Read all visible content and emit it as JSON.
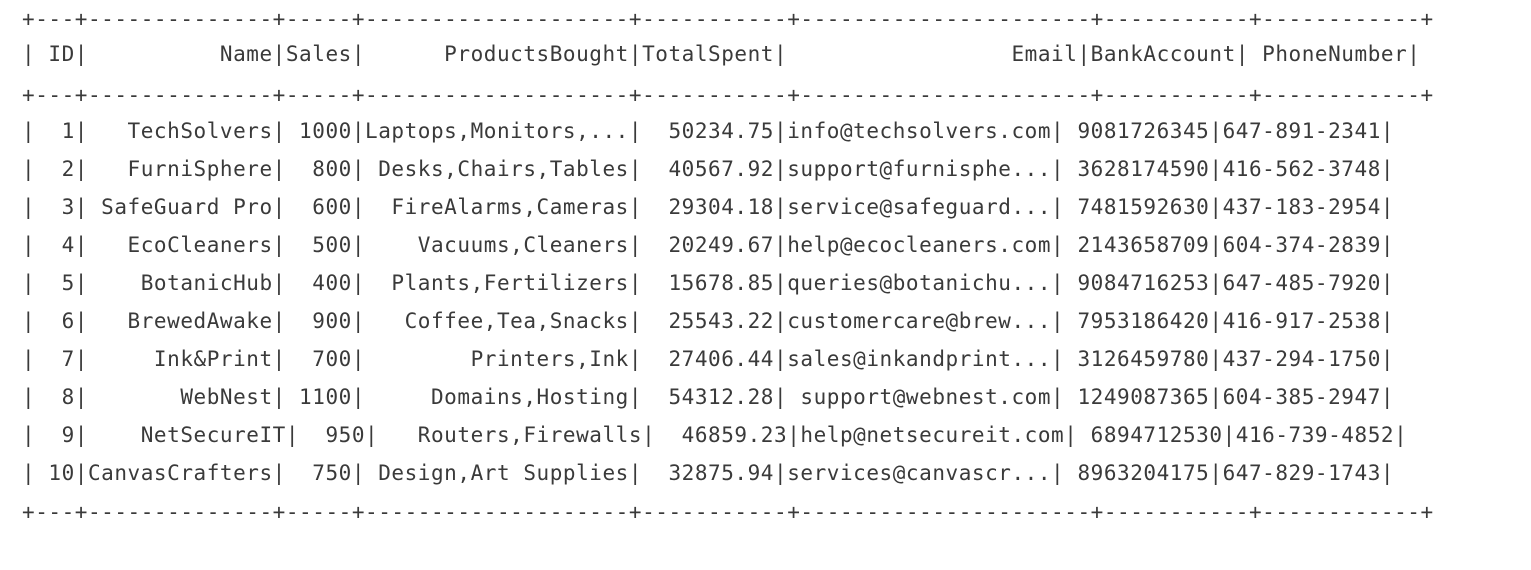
{
  "table": {
    "border": "+---+--------------+-----+--------------------+-----------+----------------------+-----------+------------+",
    "header": "| ID|          Name|Sales|      ProductsBought|TotalSpent|                 Email|BankAccount| PhoneNumber|",
    "columns": [
      "ID",
      "Name",
      "Sales",
      "ProductsBought",
      "TotalSpent",
      "Email",
      "BankAccount",
      "PhoneNumber"
    ],
    "rows": [
      "|  1|   TechSolvers| 1000|Laptops,Monitors,...|  50234.75|info@techsolvers.com| 9081726345|647-891-2341|",
      "|  2|   FurniSphere|  800| Desks,Chairs,Tables|  40567.92|support@furnisphe...| 3628174590|416-562-3748|",
      "|  3| SafeGuard Pro|  600|  FireAlarms,Cameras|  29304.18|service@safeguard...| 7481592630|437-183-2954|",
      "|  4|   EcoCleaners|  500|    Vacuums,Cleaners|  20249.67|help@ecocleaners.com| 2143658709|604-374-2839|",
      "|  5|    BotanicHub|  400|  Plants,Fertilizers|  15678.85|queries@botanichu...| 9084716253|647-485-7920|",
      "|  6|   BrewedAwake|  900|   Coffee,Tea,Snacks|  25543.22|customercare@brew...| 7953186420|416-917-2538|",
      "|  7|     Ink&Print|  700|        Printers,Ink|  27406.44|sales@inkandprint...| 3126459780|437-294-1750|",
      "|  8|       WebNest| 1100|     Domains,Hosting|  54312.28| support@webnest.com| 1249087365|604-385-2947|",
      "|  9|    NetSecureIT|  950|   Routers,Firewalls|  46859.23|help@netsecureit.com| 6894712530|416-739-4852|",
      "| 10|CanvasCrafters|  750| Design,Art Supplies|  32875.94|services@canvascr...| 8963204175|647-829-1743|"
    ]
  }
}
